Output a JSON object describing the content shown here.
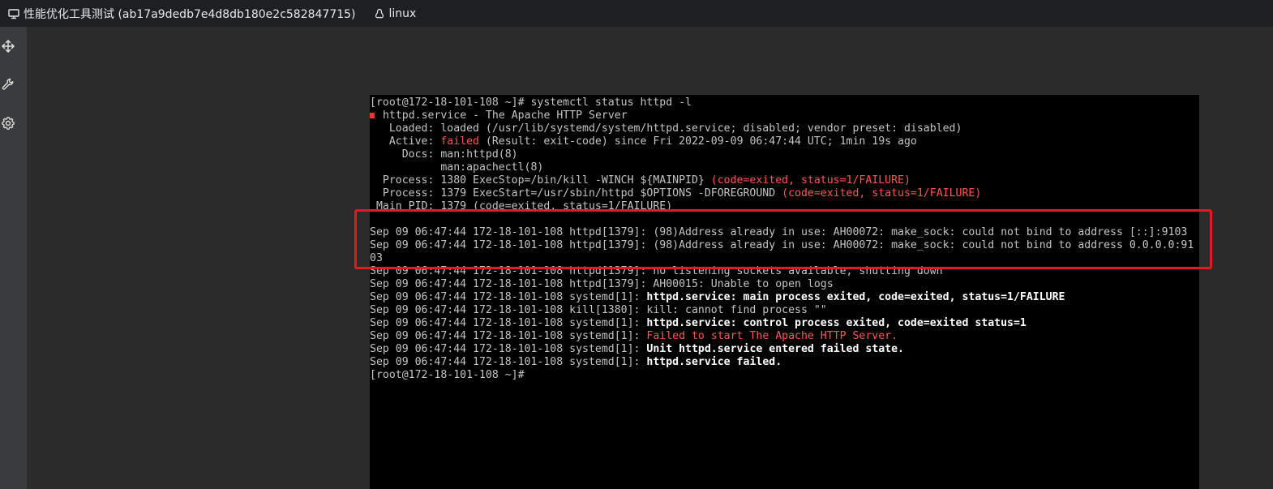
{
  "topbar": {
    "session_title": "性能优化工具测试 (ab17a9dedb7e4d8db180e2c582847715)",
    "os_label": "linux"
  },
  "sidebar": {
    "icons": [
      "move-icon",
      "wrench-icon",
      "gear-icon"
    ]
  },
  "terminal": {
    "lines": [
      {
        "segs": [
          {
            "t": "[root@172-18-101-108 ~]# systemctl status httpd -l",
            "c": ""
          }
        ]
      },
      {
        "segs": [
          {
            "t": "httpd.service - The Apache HTTP Server",
            "c": ""
          }
        ],
        "dot": true
      },
      {
        "segs": [
          {
            "t": "   Loaded: loaded (/usr/lib/systemd/system/httpd.service; disabled; vendor preset: disabled)",
            "c": ""
          }
        ]
      },
      {
        "segs": [
          {
            "t": "   Active: ",
            "c": ""
          },
          {
            "t": "failed",
            "c": "red"
          },
          {
            "t": " (Result: exit-code) since Fri 2022-09-09 06:47:44 UTC; 1min 19s ago",
            "c": ""
          }
        ]
      },
      {
        "segs": [
          {
            "t": "     Docs: man:httpd(8)",
            "c": ""
          }
        ]
      },
      {
        "segs": [
          {
            "t": "           man:apachectl(8)",
            "c": ""
          }
        ]
      },
      {
        "segs": [
          {
            "t": "  Process: 1380 ExecStop=/bin/kill -WINCH ${MAINPID} ",
            "c": ""
          },
          {
            "t": "(code=exited, status=1/FAILURE)",
            "c": "red"
          }
        ]
      },
      {
        "segs": [
          {
            "t": "  Process: 1379 ExecStart=/usr/sbin/httpd $OPTIONS -DFOREGROUND ",
            "c": ""
          },
          {
            "t": "(code=exited, status=1/FAILURE)",
            "c": "red"
          }
        ]
      },
      {
        "segs": [
          {
            "t": " Main PID: 1379 (code=exited, status=1/FAILURE)",
            "c": ""
          }
        ]
      },
      {
        "segs": [
          {
            "t": "",
            "c": ""
          }
        ]
      },
      {
        "segs": [
          {
            "t": "Sep 09 06:47:44 172-18-101-108 httpd[1379]: (98)Address already in use: AH00072: make_sock: could not bind to address [::]:9103",
            "c": ""
          }
        ]
      },
      {
        "segs": [
          {
            "t": "Sep 09 06:47:44 172-18-101-108 httpd[1379]: (98)Address already in use: AH00072: make_sock: could not bind to address 0.0.0.0:91",
            "c": ""
          }
        ]
      },
      {
        "segs": [
          {
            "t": "03",
            "c": ""
          }
        ]
      },
      {
        "segs": [
          {
            "t": "Sep 09 06:47:44 172-18-101-108 httpd[1379]: no listening sockets available, shutting down",
            "c": ""
          }
        ]
      },
      {
        "segs": [
          {
            "t": "Sep 09 06:47:44 172-18-101-108 httpd[1379]: AH00015: Unable to open logs",
            "c": ""
          }
        ]
      },
      {
        "segs": [
          {
            "t": "Sep 09 06:47:44 172-18-101-108 systemd[1]: ",
            "c": ""
          },
          {
            "t": "httpd.service: main process exited, code=exited, status=1/FAILURE",
            "c": "bold"
          }
        ]
      },
      {
        "segs": [
          {
            "t": "Sep 09 06:47:44 172-18-101-108 kill[1380]: kill: cannot find process \"\"",
            "c": ""
          }
        ]
      },
      {
        "segs": [
          {
            "t": "Sep 09 06:47:44 172-18-101-108 systemd[1]: ",
            "c": ""
          },
          {
            "t": "httpd.service: control process exited, code=exited status=1",
            "c": "bold"
          }
        ]
      },
      {
        "segs": [
          {
            "t": "Sep 09 06:47:44 172-18-101-108 systemd[1]: ",
            "c": ""
          },
          {
            "t": "Failed to start The Apache HTTP Server.",
            "c": "redb"
          }
        ]
      },
      {
        "segs": [
          {
            "t": "Sep 09 06:47:44 172-18-101-108 systemd[1]: ",
            "c": ""
          },
          {
            "t": "Unit httpd.service entered failed state.",
            "c": "bold"
          }
        ]
      },
      {
        "segs": [
          {
            "t": "Sep 09 06:47:44 172-18-101-108 systemd[1]: ",
            "c": ""
          },
          {
            "t": "httpd.service failed.",
            "c": "bold"
          }
        ]
      },
      {
        "segs": [
          {
            "t": "[root@172-18-101-108 ~]#",
            "c": ""
          }
        ]
      }
    ]
  },
  "colors": {
    "error_red": "#ff5555",
    "highlight_box": "#e8191c"
  }
}
